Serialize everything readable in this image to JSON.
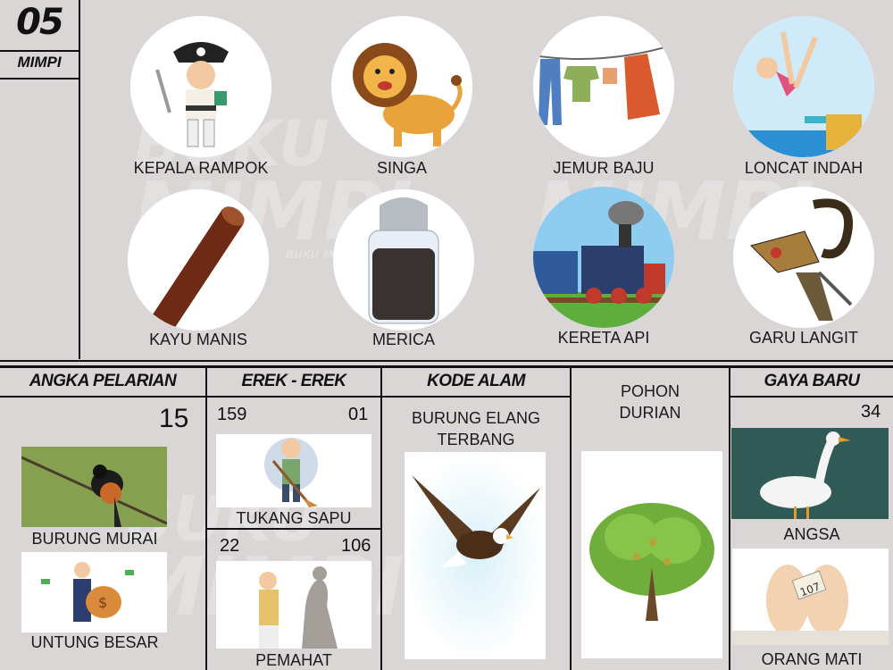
{
  "badge": {
    "number": "05",
    "label": "MIMPI"
  },
  "watermark": {
    "line1": "BUKU",
    "line2": "MIMPI",
    "small": "BUKU MIMPI"
  },
  "dreams": [
    {
      "label": "KEPALA RAMPOK",
      "icon": "pirate-icon"
    },
    {
      "label": "SINGA",
      "icon": "lion-icon"
    },
    {
      "label": "JEMUR BAJU",
      "icon": "clothesline-icon"
    },
    {
      "label": "LONCAT INDAH",
      "icon": "diver-icon"
    },
    {
      "label": "KAYU MANIS",
      "icon": "cinnamon-icon"
    },
    {
      "label": "MERICA",
      "icon": "pepper-shaker-icon"
    },
    {
      "label": "KERETA API",
      "icon": "train-icon"
    },
    {
      "label": "GARU LANGIT",
      "icon": "wayang-icon"
    }
  ],
  "sections": {
    "angka_pelarian": {
      "header": "ANGKA PELARIAN",
      "number": "15",
      "items": [
        {
          "label": "BURUNG MURAI",
          "icon": "magpie-robin-icon"
        },
        {
          "label": "UNTUNG BESAR",
          "icon": "money-bag-icon"
        }
      ]
    },
    "erek_erek": {
      "header": "EREK - EREK",
      "items": [
        {
          "left": "159",
          "right": "01",
          "label": "TUKANG SAPU",
          "icon": "sweeper-icon"
        },
        {
          "left": "22",
          "right": "106",
          "label": "PEMAHAT",
          "icon": "sculptor-icon"
        }
      ]
    },
    "kode_alam": {
      "header": "KODE ALAM",
      "line1": "BURUNG ELANG",
      "line2": "TERBANG",
      "icon": "eagle-icon",
      "side_line1": "POHON",
      "side_line2": "DURIAN",
      "side_icon": "durian-tree-icon"
    },
    "gaya_baru": {
      "header": "GAYA BARU",
      "number": "34",
      "items": [
        {
          "label": "ANGSA",
          "icon": "goose-icon"
        },
        {
          "label": "ORANG MATI",
          "icon": "feet-tag-icon",
          "tag": "107"
        }
      ]
    }
  }
}
